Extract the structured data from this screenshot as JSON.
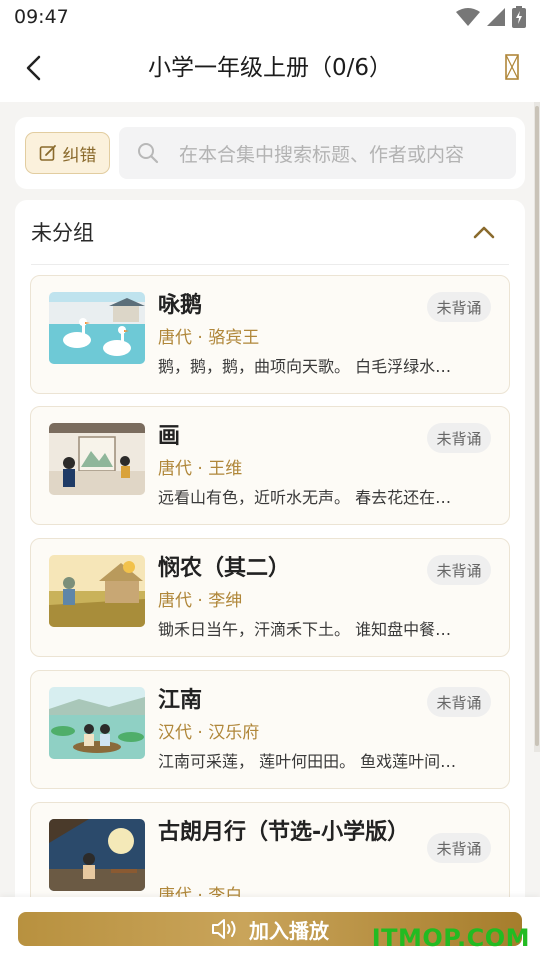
{
  "status_bar": {
    "time": "09:47"
  },
  "header": {
    "title": "小学一年级上册（0/6）"
  },
  "toolbar": {
    "correct_label": "纠错",
    "search_placeholder": "在本合集中搜索标题、作者或内容"
  },
  "group": {
    "title": "未分组"
  },
  "poems": [
    {
      "title": "咏鹅",
      "meta": "唐代 · 骆宾王",
      "excerpt": "鹅，鹅，鹅，曲项向天歌。 白毛浮绿水…",
      "status": "未背诵"
    },
    {
      "title": "画",
      "meta": "唐代 · 王维",
      "excerpt": "远看山有色，近听水无声。 春去花还在…",
      "status": "未背诵"
    },
    {
      "title": "悯农（其二）",
      "meta": "唐代 · 李绅",
      "excerpt": "锄禾日当午，汗滴禾下土。 谁知盘中餐…",
      "status": "未背诵"
    },
    {
      "title": "江南",
      "meta": "汉代 · 汉乐府",
      "excerpt": "江南可采莲， 莲叶何田田。 鱼戏莲叶间…",
      "status": "未背诵"
    },
    {
      "title": "古朗月行（节选-小学版）",
      "meta": "唐代 · 李白",
      "excerpt": "",
      "status": "未背诵"
    }
  ],
  "bottom": {
    "play_label": "加入播放"
  },
  "watermark": "ITMOP.COM",
  "colors": {
    "accent": "#b0873a",
    "button": "#b8913f"
  },
  "icons": [
    "wifi-icon",
    "signal-icon",
    "battery-icon",
    "back-icon",
    "menu-icon",
    "edit-icon",
    "search-icon",
    "chevron-up-icon",
    "speaker-icon"
  ]
}
